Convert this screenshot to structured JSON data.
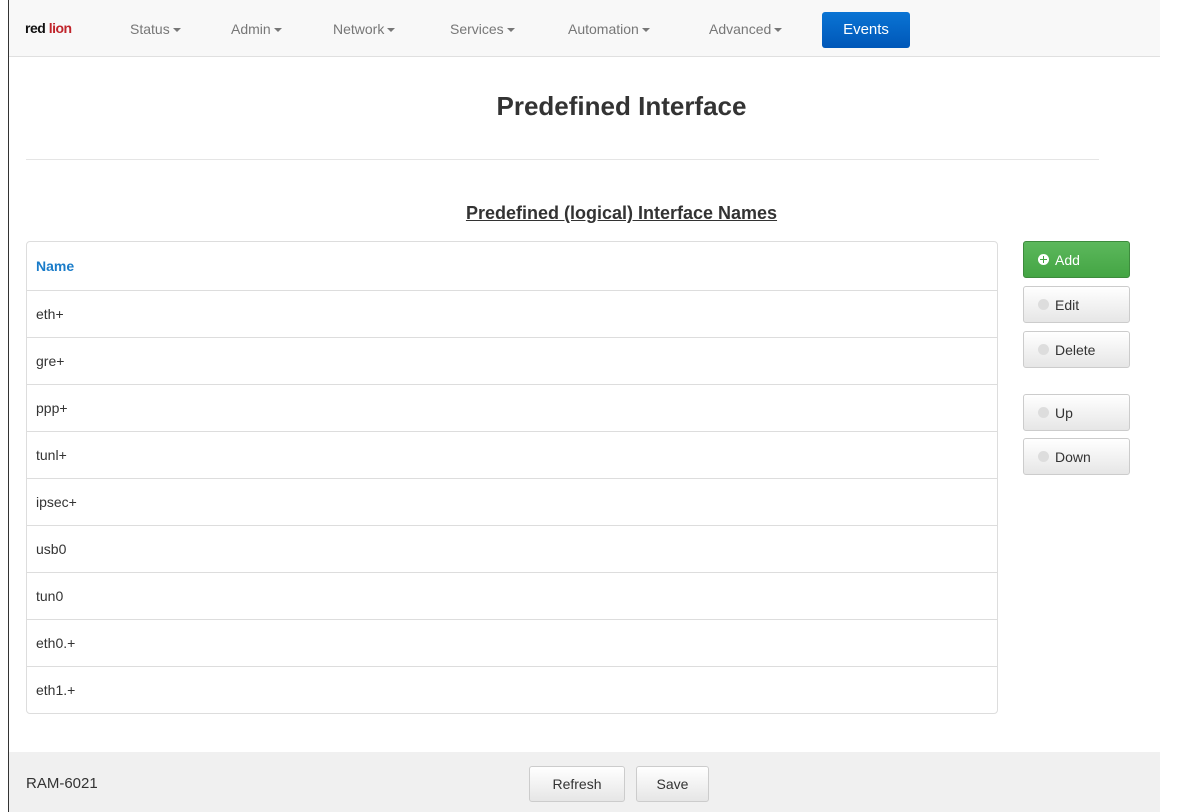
{
  "navbar": {
    "brand_red": "red",
    "brand_lion": "lion",
    "items": [
      {
        "label": "Status"
      },
      {
        "label": "Admin"
      },
      {
        "label": "Network"
      },
      {
        "label": "Services"
      },
      {
        "label": "Automation"
      },
      {
        "label": "Advanced"
      }
    ],
    "active": "Events"
  },
  "page": {
    "title": "Predefined Interface",
    "section_title": "Predefined (logical) Interface Names"
  },
  "table": {
    "header": "Name",
    "rows": [
      "eth+",
      "gre+",
      "ppp+",
      "tunl+",
      "ipsec+",
      "usb0",
      "tun0",
      "eth0.+",
      "eth1.+"
    ]
  },
  "actions": {
    "add": "Add",
    "edit": "Edit",
    "delete": "Delete",
    "up": "Up",
    "down": "Down"
  },
  "footer": {
    "model": "RAM-6021",
    "refresh": "Refresh",
    "save": "Save"
  },
  "colors": {
    "accent_blue": "#0a74d4",
    "add_green": "#5cb85c",
    "header_text_blue": "#1a7cc9",
    "brand_red": "#c0242b"
  },
  "icons": {
    "add": "plus-circle-icon",
    "edit": "check-circle-icon",
    "delete": "minus-circle-icon",
    "up": "arrow-up-circle-icon",
    "down": "arrow-down-circle-icon"
  }
}
